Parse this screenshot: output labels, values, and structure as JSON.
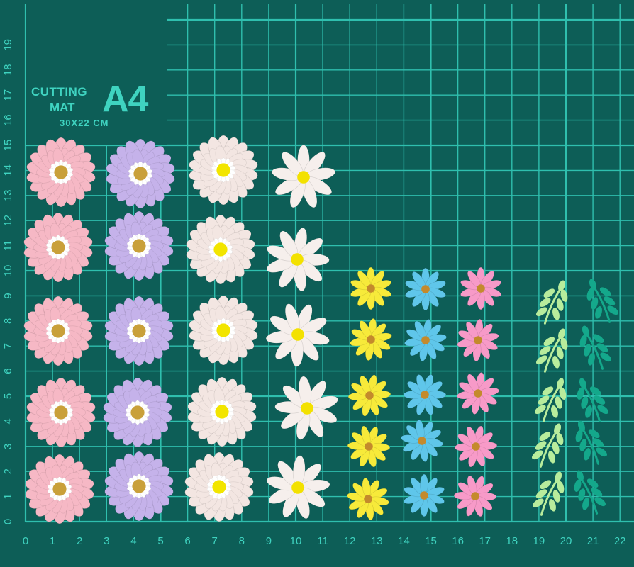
{
  "mat": {
    "label_line1": "CUTTING",
    "label_line2": "MAT",
    "size_label": "A4",
    "dimensions": "30X22 CM",
    "x_ticks": [
      "0",
      "1",
      "2",
      "3",
      "4",
      "5",
      "6",
      "7",
      "8",
      "9",
      "10",
      "11",
      "12",
      "13",
      "14",
      "15",
      "16",
      "17",
      "18",
      "19",
      "20",
      "21",
      "22",
      "2"
    ],
    "y_ticks": [
      "0",
      "1",
      "2",
      "3",
      "4",
      "5",
      "6",
      "7",
      "8",
      "9",
      "10",
      "11",
      "12",
      "13",
      "14",
      "15",
      "16",
      "17",
      "18",
      "19"
    ]
  },
  "colors": {
    "mat": "#0d5e57",
    "grid": "#2fbfae",
    "text": "#3fd3c0",
    "pink_flower": "#f6b8c5",
    "lavender_flower": "#c5b2ea",
    "cream_flower": "#f3e6e2",
    "white_daisy": "#f6efec",
    "yellow_flower": "#f7ea3a",
    "blue_flower": "#5fc6ea",
    "hotpink_flower": "#f79ac8",
    "lime_leaf": "#b8ec9c",
    "teal_leaf": "#14a88b"
  }
}
